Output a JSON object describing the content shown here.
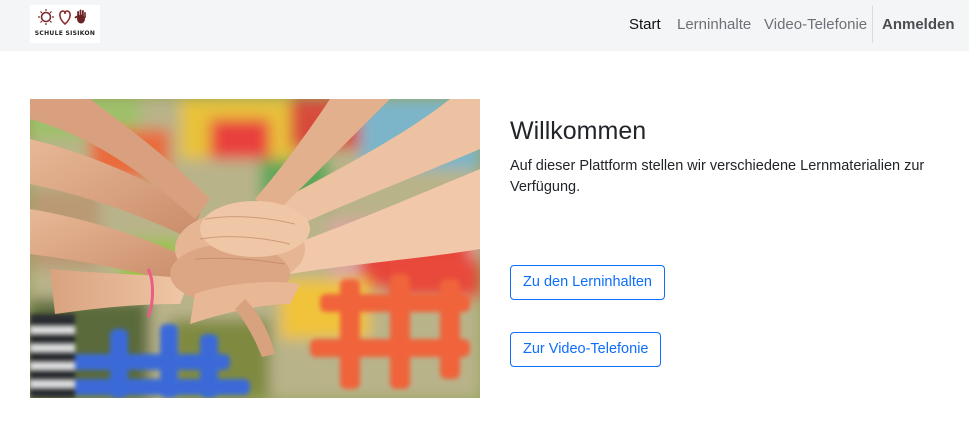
{
  "header": {
    "logo_text": "SCHULE SISIKON",
    "nav": {
      "start": "Start",
      "lerninhalte": "Lerninhalte",
      "video": "Video-Telefonie",
      "login": "Anmelden"
    }
  },
  "main": {
    "title": "Willkommen",
    "lead": "Auf dieser Plattform stellen wir verschiedene Lernmaterialien zur Verfügung.",
    "button_lerninhalte": "Zu den Lerninhalten",
    "button_video": "Zur Video-Telefonie",
    "hero_image": "children-hands-stacked-photo"
  },
  "colors": {
    "navbar_bg": "#f4f5f7",
    "primary": "#0d6efd"
  }
}
